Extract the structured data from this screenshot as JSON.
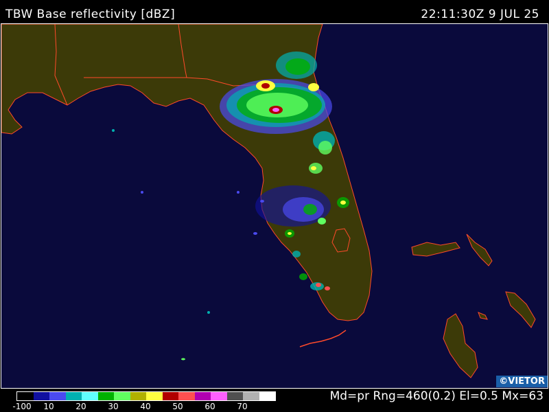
{
  "header": {
    "title": "TBW Base reflectivity [dBZ]",
    "timestamp": "22:11:30Z  9 JUL 25"
  },
  "credit": "©VIETOR",
  "footer": {
    "params": "Md=pr Rng=460(0.2) El=0.5 Mx=63"
  },
  "legend": {
    "colors": [
      "#000000",
      "#1010a0",
      "#4a4af0",
      "#00b0b0",
      "#60ffff",
      "#00b000",
      "#60ff60",
      "#b0b000",
      "#ffff40",
      "#b00000",
      "#ff5050",
      "#b000b0",
      "#ff60ff",
      "#505050",
      "#b0b0b0",
      "#ffffff"
    ],
    "tick_labels": [
      "-100",
      "10",
      "20",
      "30",
      "40",
      "50",
      "60",
      "70"
    ]
  },
  "colors": {
    "water": "#0a0a3c",
    "land": "#3c3a08",
    "border": "#ff4a2a"
  }
}
